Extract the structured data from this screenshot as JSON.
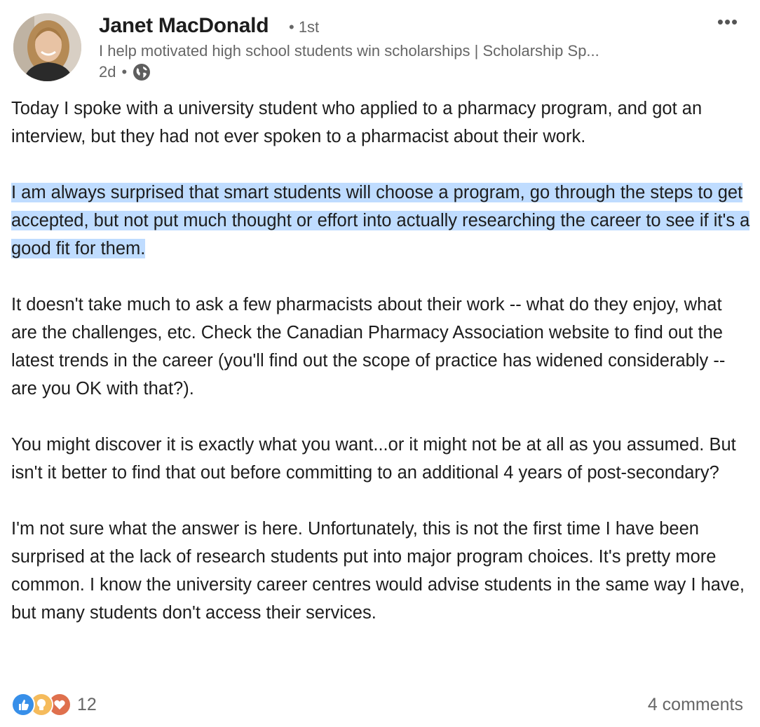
{
  "post": {
    "author": {
      "name": "Janet MacDonald",
      "degree": "• 1st",
      "headline": "I help motivated high school students win scholarships | Scholarship Sp...",
      "time": "2d",
      "visibility_icon": "globe-icon"
    },
    "more_label": "•••",
    "paragraphs": [
      "Today I spoke with a university student who applied to a pharmacy program, and got an interview, but they had not ever spoken to a pharmacist about their work.",
      "I am always surprised that smart students will choose a program, go through the steps to get accepted, but not put much thought or effort into actually researching the career to see if it's a good fit for them.",
      "It doesn't take much to ask a few pharmacists about their work -- what do they enjoy, what are the challenges, etc. Check the Canadian Pharmacy Association website to find out the latest trends in the career (you'll find out the scope of practice has widened considerably -- are you OK with that?).",
      "You might discover it is exactly what you want...or it might not be at all as you assumed. But isn't it better to find that out before committing to an additional 4 years of post-secondary?",
      "I'm not sure what the answer is here. Unfortunately, this is not the first time I have been surprised at the lack of research students put into major program choices. It's pretty more common. I know the university career centres would advise students in the same way I have, but many students don't access their services."
    ],
    "reactions": {
      "icons": [
        "like-icon",
        "insightful-icon",
        "love-icon"
      ],
      "count": "12"
    },
    "comments_label": "4 comments"
  },
  "colors": {
    "highlight": "#bfdcff",
    "like": "#378fe9",
    "insightful": "#f5bb5c",
    "love": "#df704d"
  }
}
